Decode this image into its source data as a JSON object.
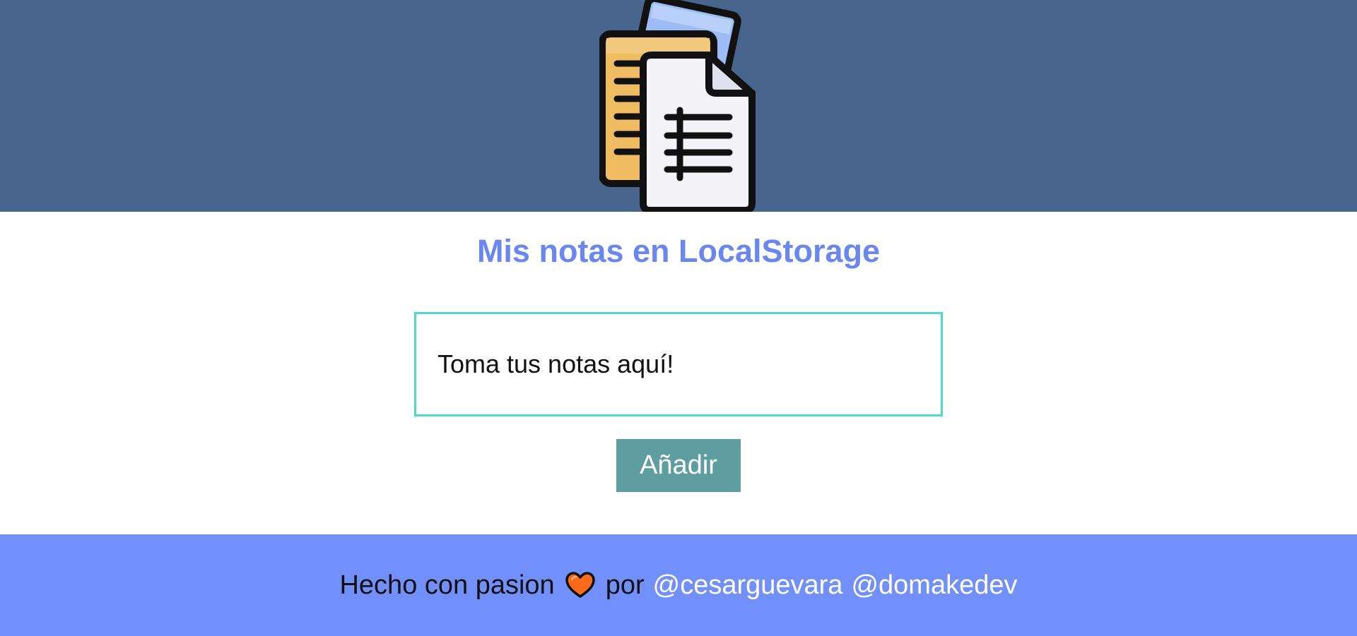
{
  "header": {
    "background": "#48668d",
    "logo_icon": "documents-icon"
  },
  "main": {
    "title": "Mis notas en LocalStorage",
    "title_color": "#6a86ef",
    "note_input": {
      "placeholder": "Toma tus notas aquí!",
      "value": "",
      "border_color": "#4fd8cf"
    },
    "add_button": {
      "label": "Añadir",
      "background": "#5f9ea0"
    }
  },
  "footer": {
    "background": "#7190fc",
    "text_before": "Hecho con pasion",
    "heart_icon": "heart-icon",
    "text_middle": "por",
    "author_1": "@cesarguevara",
    "author_2": "@domakedev"
  }
}
